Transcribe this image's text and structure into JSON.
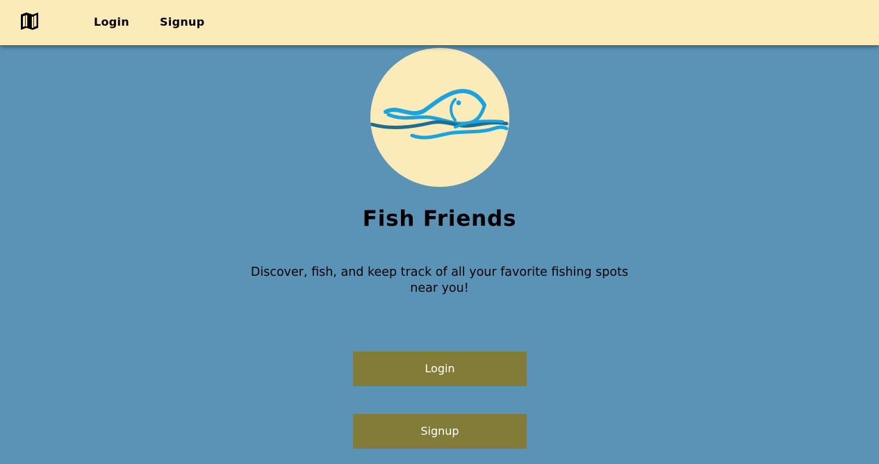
{
  "nav": {
    "logo_icon": "map-icon",
    "login_label": "Login",
    "signup_label": "Signup"
  },
  "hero": {
    "logo_icon": "fish-icon",
    "title": "Fish Friends",
    "tagline": "Discover, fish, and keep track of all your favorite fishing spots near you!"
  },
  "actions": {
    "login_label": "Login",
    "signup_label": "Signup"
  },
  "colors": {
    "background": "#5b93b7",
    "navbar": "#fbebb9",
    "button": "#827c38",
    "logo_circle": "#fbebb9",
    "fish_light": "#1aa3de",
    "fish_dark": "#1d6e93"
  }
}
